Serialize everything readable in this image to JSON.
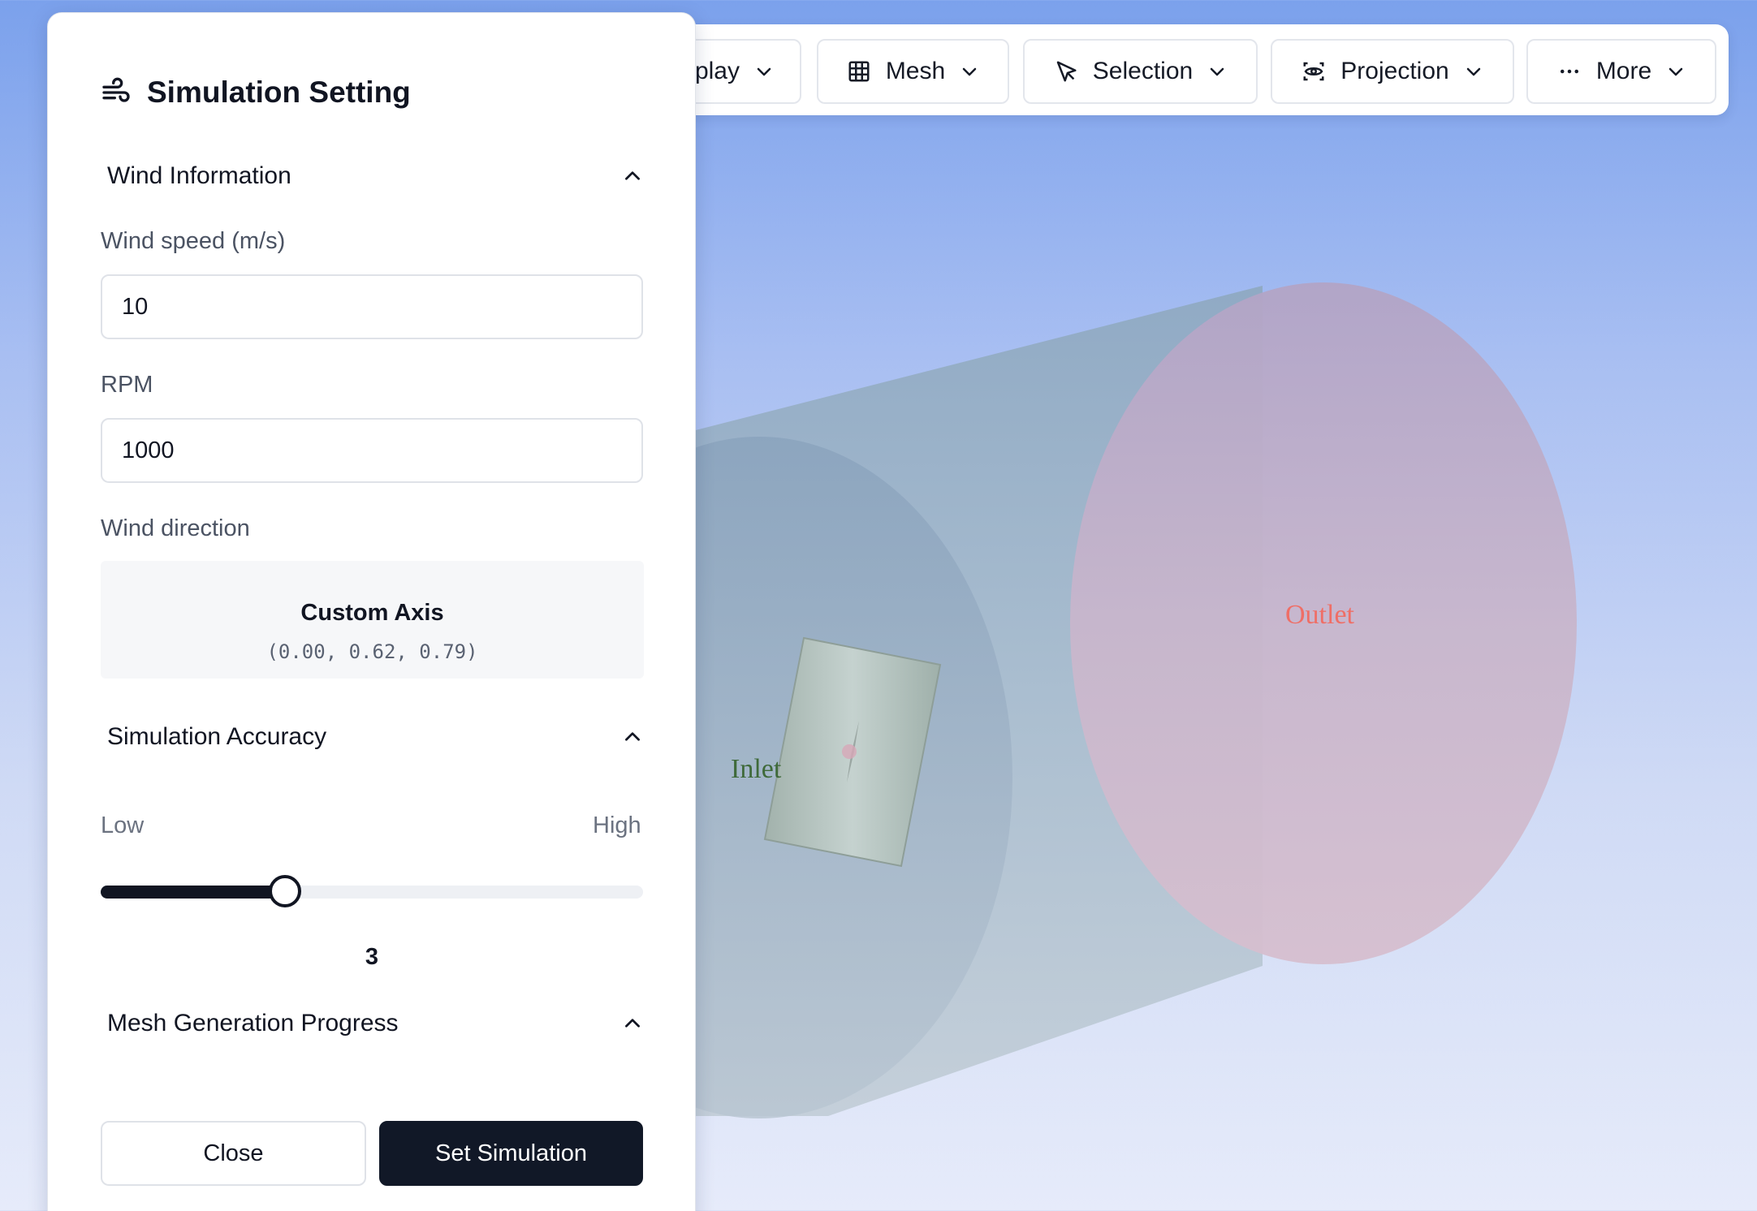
{
  "toolbar": {
    "items": [
      {
        "label": "Display",
        "visible_label": "play",
        "icon": "display-icon"
      },
      {
        "label": "Mesh",
        "icon": "grid-icon"
      },
      {
        "label": "Selection",
        "icon": "cursor-arrow-icon"
      },
      {
        "label": "Projection",
        "icon": "eye-icon"
      },
      {
        "label": "More",
        "icon": "more-dots-icon"
      }
    ]
  },
  "viewport": {
    "inlet_label": "Inlet",
    "outlet_label": "Outlet",
    "colors": {
      "inlet_text": "#3f6a3a",
      "outlet_text": "#ef6e66",
      "outlet_face": "#d8b4c8",
      "cylinder": "#a6bacc",
      "rotor": "#b6c4c0"
    }
  },
  "panel": {
    "title": "Simulation Setting",
    "title_icon": "wind-icon",
    "sections": {
      "wind": {
        "header": "Wind Information",
        "speed_label": "Wind speed (m/s)",
        "speed_value": "10",
        "rpm_label": "RPM",
        "rpm_value": "1000",
        "direction_label": "Wind direction",
        "direction_title": "Custom Axis",
        "direction_coords": "(0.00, 0.62, 0.79)"
      },
      "accuracy": {
        "header": "Simulation Accuracy",
        "low_label": "Low",
        "high_label": "High",
        "value": 3,
        "value_text": "3",
        "fraction": 0.34
      },
      "mesh": {
        "header": "Mesh Generation Progress"
      }
    },
    "buttons": {
      "close": "Close",
      "submit": "Set Simulation"
    }
  },
  "colors": {
    "primary": "#111827",
    "background_top": "#7ba1ec",
    "background_bottom": "#e6ebfa"
  }
}
